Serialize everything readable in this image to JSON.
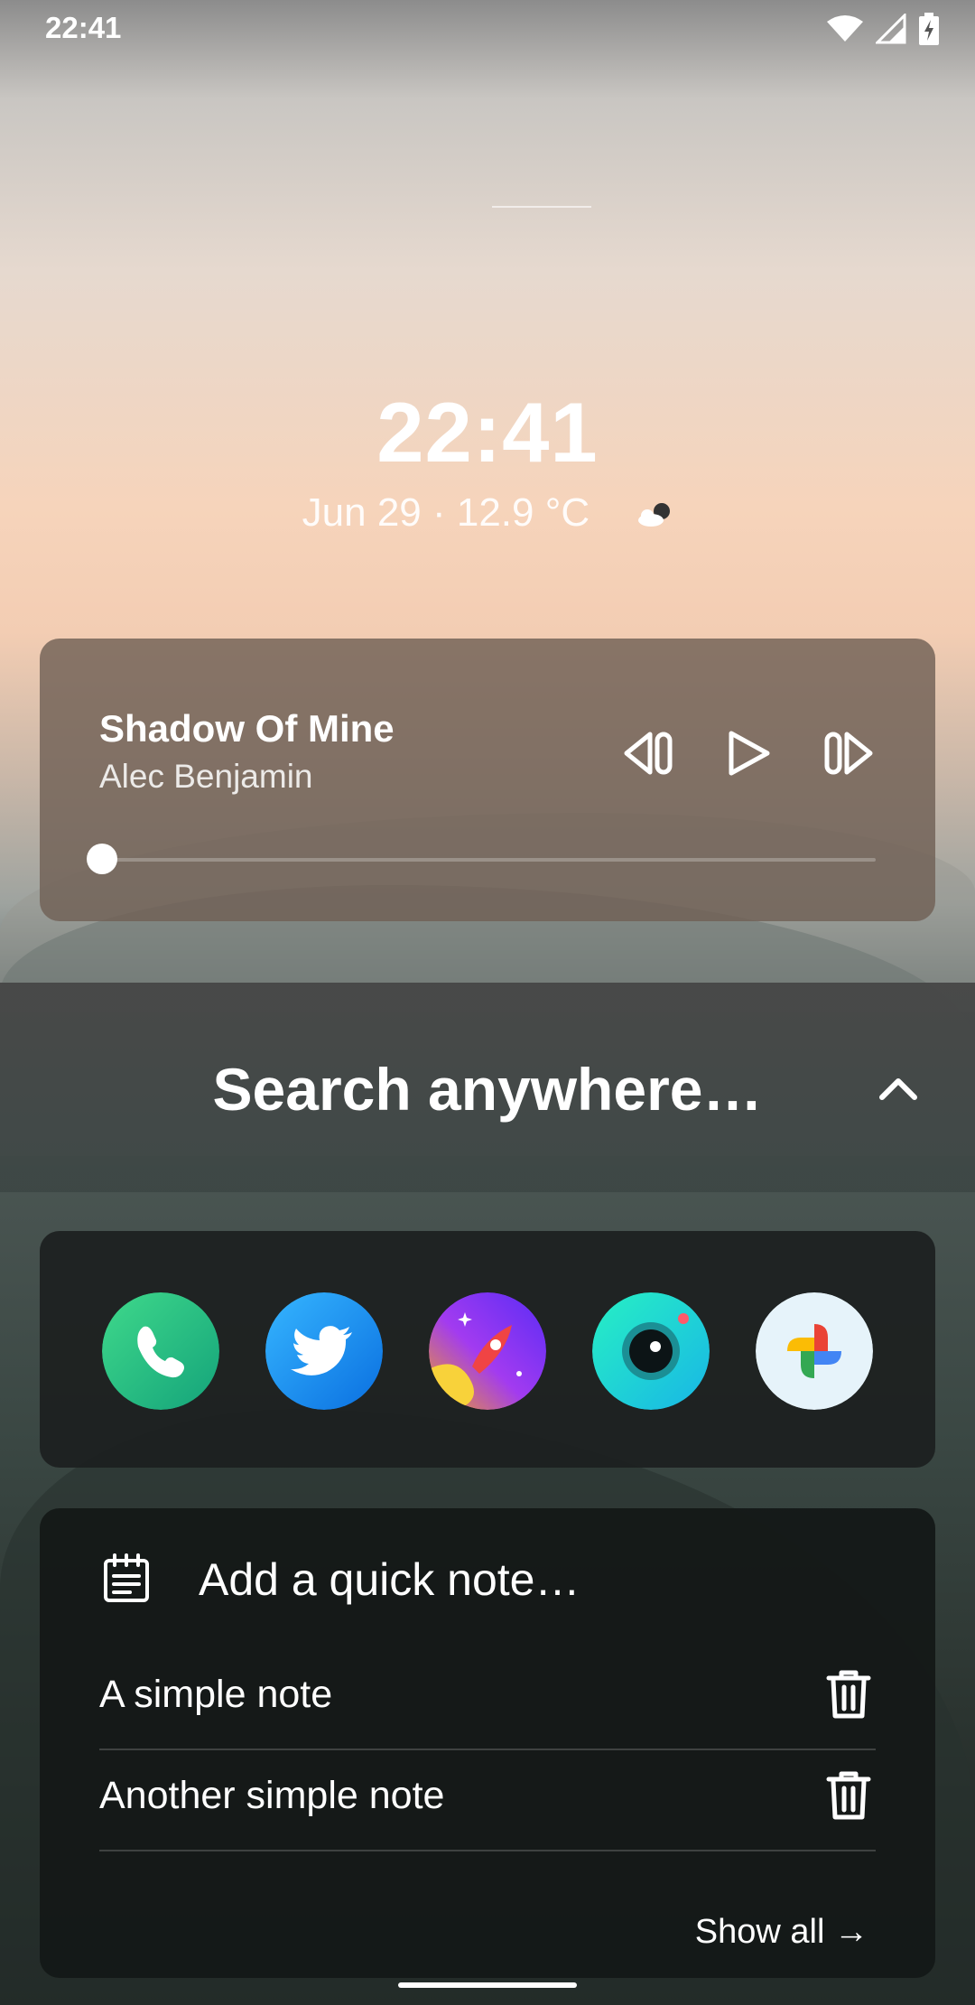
{
  "status_bar": {
    "time": "22:41",
    "icons": [
      "wifi-icon",
      "signal-icon",
      "battery-charging-icon"
    ]
  },
  "clock": {
    "time": "22:41",
    "date_weather": "Jun 29 · 12.9 °C",
    "weather_icon": "partly-cloudy-night-icon"
  },
  "media": {
    "title": "Shadow Of Mine",
    "artist": "Alec Benjamin",
    "controls": [
      "previous-icon",
      "play-icon",
      "next-icon"
    ],
    "progress_fraction": 0.0
  },
  "search": {
    "placeholder": "Search anywhere…"
  },
  "apps": [
    {
      "name": "phone",
      "icon": "phone-icon",
      "color": "#2ec27e"
    },
    {
      "name": "twitter",
      "icon": "twitter-icon",
      "color": "#1d9bf0"
    },
    {
      "name": "rocket",
      "icon": "rocket-icon",
      "color": "#7b2ff7"
    },
    {
      "name": "camera",
      "icon": "camera-icon",
      "color": "#20d4c4"
    },
    {
      "name": "photos",
      "icon": "photos-icon",
      "color": "#e8f2f8"
    }
  ],
  "notes": {
    "add_placeholder": "Add a quick note…",
    "items": [
      {
        "text": "A simple note"
      },
      {
        "text": "Another simple note"
      }
    ],
    "show_all": "Show all →"
  }
}
